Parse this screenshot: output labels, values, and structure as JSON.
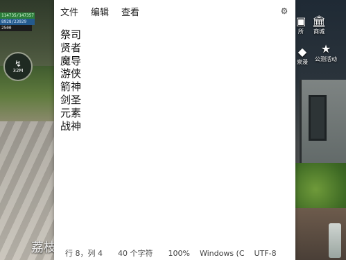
{
  "menu": {
    "file": "文件",
    "edit": "编辑",
    "view": "查看"
  },
  "settings_icon": "gear-icon",
  "lines": [
    "祭司",
    "贤者",
    "魔导",
    "游侠",
    "箭神",
    "剑圣",
    "元素",
    "战神"
  ],
  "status": {
    "position": "行 8，列 4",
    "chars": "40 个字符",
    "zoom": "100%",
    "line_ending": "Windows (C",
    "encoding": "UTF-8"
  },
  "game": {
    "hud_bar_1": "114735/147357",
    "hud_bar_2": "8928/23929",
    "hud_bar_3": "2500",
    "minimap_value": "32M",
    "mall_label": "商城",
    "mall_label_cut": "所",
    "event_label": "公测活动",
    "other_label": "泉漫",
    "bottom_text": "荔枝"
  },
  "colors": {
    "notepad_bg": "#ffffff",
    "text": "#111111"
  }
}
